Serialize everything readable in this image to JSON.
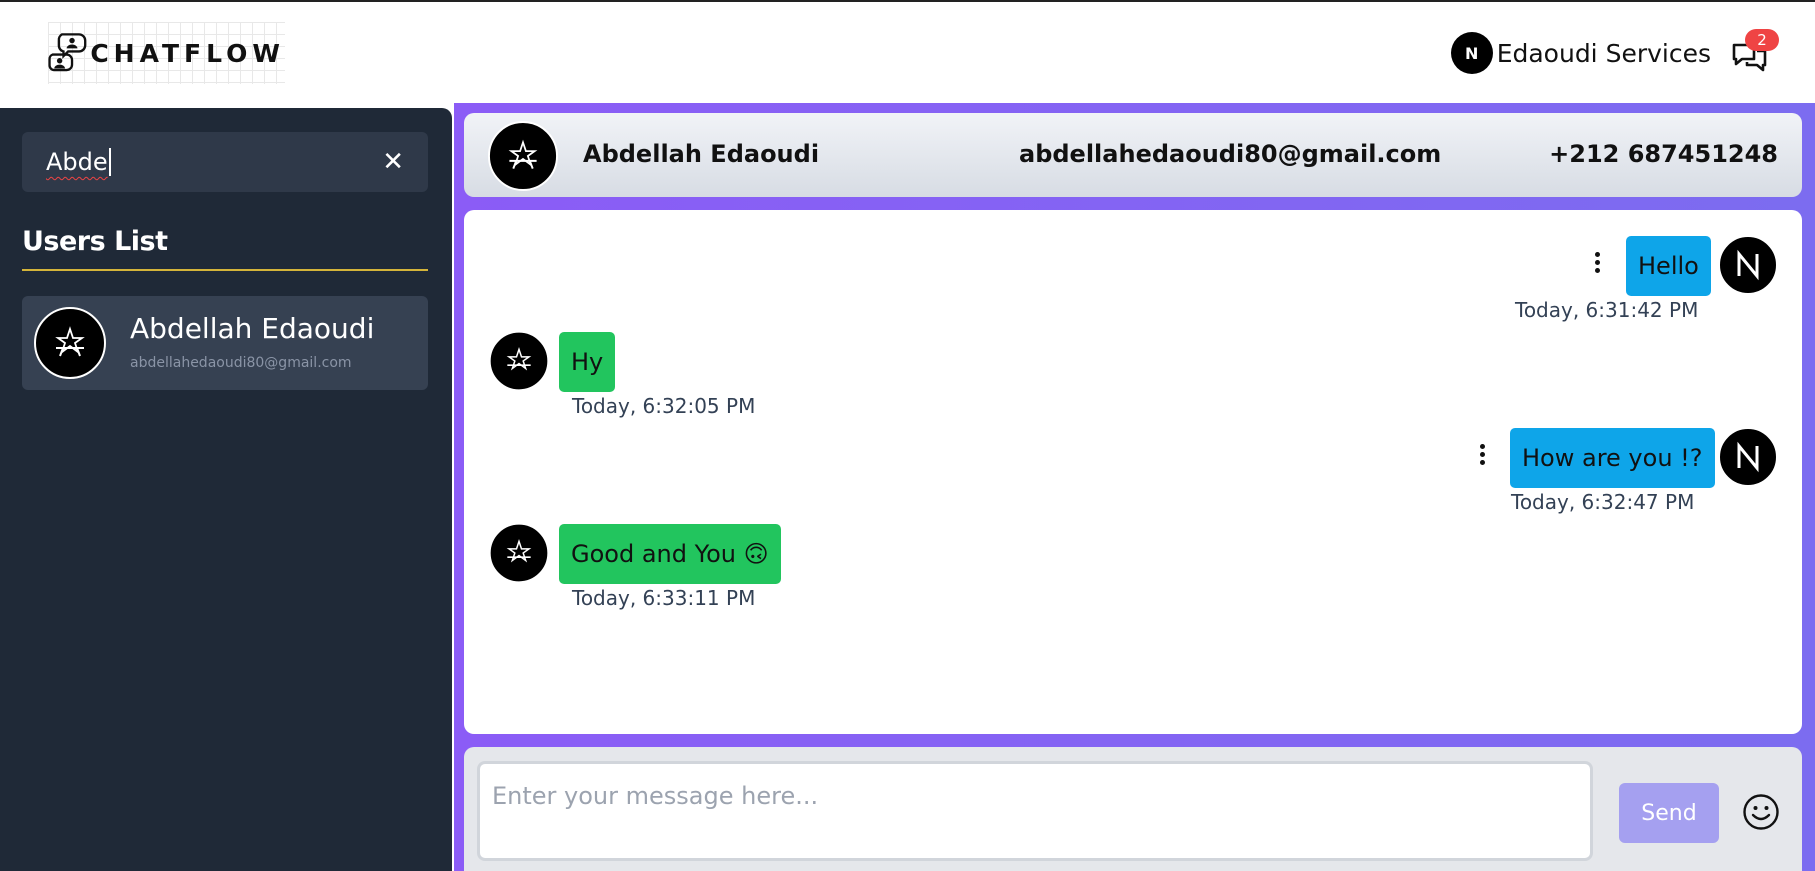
{
  "header": {
    "brand": "CHATFLOW",
    "current_user": {
      "name": "Edaoudi Services",
      "initial": "N"
    },
    "notification_count": "2"
  },
  "sidebar": {
    "search": {
      "value": "Abde"
    },
    "title": "Users List",
    "users": [
      {
        "name": "Abdellah Edaoudi",
        "email": "abdellahedaoudi80@gmail.com"
      }
    ]
  },
  "chat": {
    "contact": {
      "name": "Abdellah Edaoudi",
      "email": "abdellahedaoudi80@gmail.com",
      "phone": "+212 687451248"
    },
    "messages": [
      {
        "text": "Hello",
        "time": "Today,  6:31:42 PM",
        "side": "sent"
      },
      {
        "text": "Hy",
        "time": "Today,  6:32:05 PM",
        "side": "received"
      },
      {
        "text": "How are you !?",
        "time": "Today,  6:32:47 PM",
        "side": "sent"
      },
      {
        "text": "Good and You 🙃",
        "time": "Today,  6:33:11 PM",
        "side": "received"
      }
    ]
  },
  "composer": {
    "placeholder": "Enter your message here...",
    "send_label": "Send"
  },
  "colors": {
    "sent_bubble": "#0ea5e9",
    "received_bubble": "#22c55e",
    "sidebar_bg": "#1f2937",
    "accent_purple": "#8b5cf6",
    "badge": "#ef4444"
  }
}
